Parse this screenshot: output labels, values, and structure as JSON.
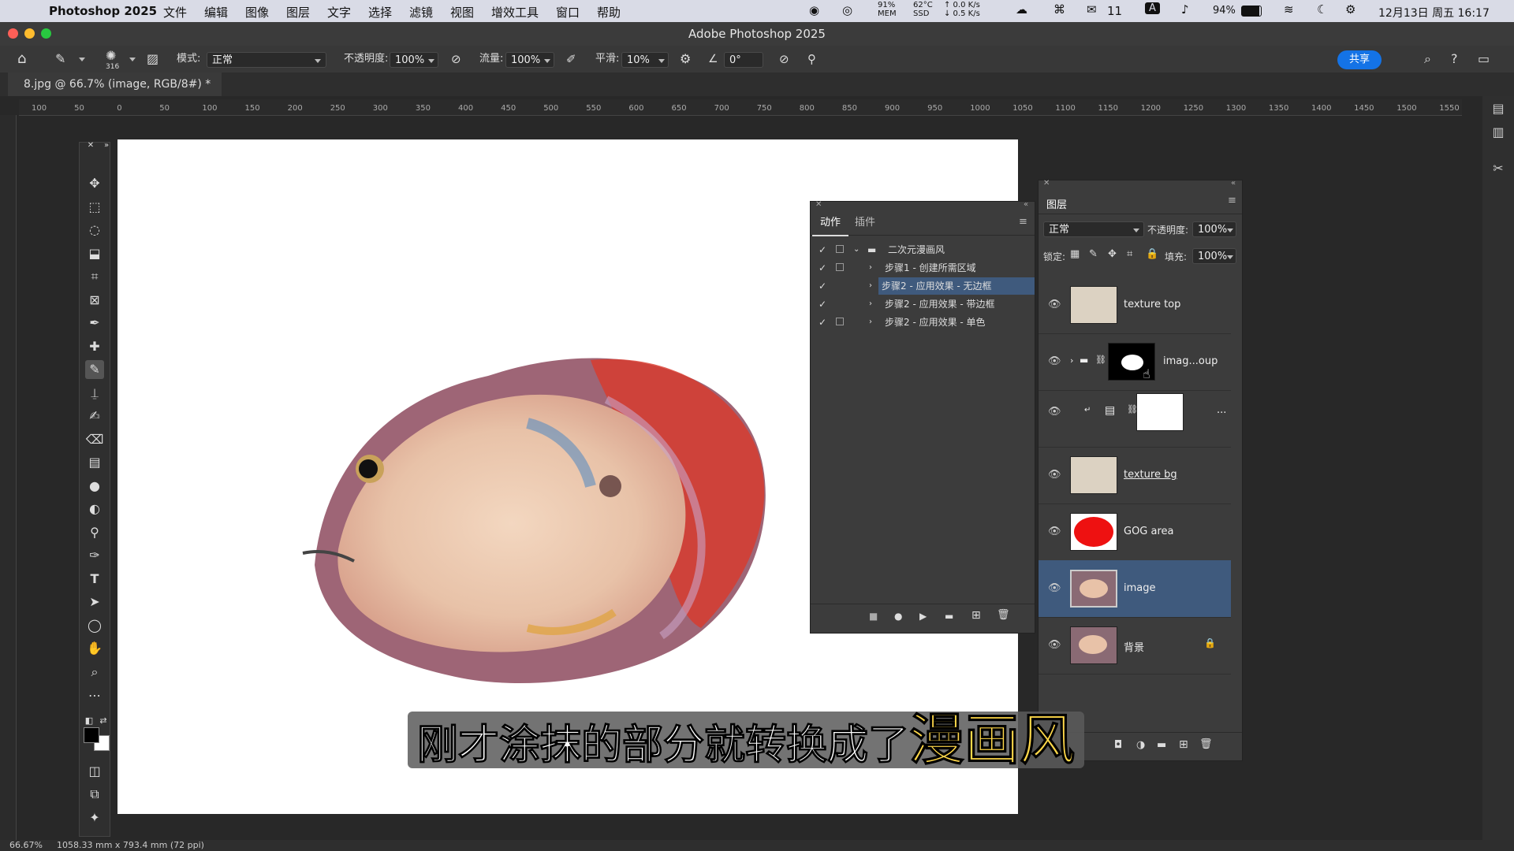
{
  "menubar": {
    "app_name": "Photoshop 2025",
    "items": [
      "文件",
      "编辑",
      "图像",
      "图层",
      "文字",
      "选择",
      "滤镜",
      "视图",
      "增效工具",
      "窗口",
      "帮助"
    ],
    "cpu": "91%",
    "cpu_sub": "MEM",
    "temp": "62°C",
    "temp_sub": "SSD",
    "net_up": "↑ 0.0 K/s",
    "net_down": "↓ 0.5 K/s",
    "wechat_count": "11",
    "input_method": "A",
    "battery": "94%",
    "datetime": "12月13日 周五 16:17"
  },
  "window": {
    "title": "Adobe Photoshop 2025"
  },
  "options": {
    "brush_size": "316",
    "mode_label": "模式:",
    "mode_value": "正常",
    "opacity_label": "不透明度:",
    "opacity_value": "100%",
    "flow_label": "流量:",
    "flow_value": "100%",
    "smooth_label": "平滑:",
    "smooth_value": "10%",
    "angle_value": "0°",
    "share_label": "共享"
  },
  "document": {
    "tab_title": "8.jpg @ 66.7% (image, RGB/8#) *"
  },
  "ruler": {
    "labels": [
      "100",
      "50",
      "0",
      "50",
      "100",
      "150",
      "200",
      "250",
      "300",
      "350",
      "400",
      "450",
      "500",
      "550",
      "600",
      "650",
      "700",
      "750",
      "800",
      "850",
      "900",
      "950",
      "1000",
      "1050",
      "1100",
      "1150",
      "1200",
      "1250",
      "1300",
      "1350",
      "1400",
      "1450",
      "1500",
      "1550"
    ]
  },
  "actions_panel": {
    "tabs": [
      "动作",
      "插件"
    ],
    "set_name": "二次元漫画风",
    "actions": [
      {
        "label": "步骤1 - 创建所需区域",
        "selected": false
      },
      {
        "label": "步骤2 - 应用效果 - 无边框",
        "selected": true
      },
      {
        "label": "步骤2 - 应用效果 - 带边框",
        "selected": false
      },
      {
        "label": "步骤2 - 应用效果 - 单色",
        "selected": false
      }
    ]
  },
  "layers_panel": {
    "title": "图层",
    "blend_mode": "正常",
    "opacity_label": "不透明度:",
    "opacity_value": "100%",
    "lock_label": "锁定:",
    "fill_label": "填充:",
    "fill_value": "100%",
    "layers": [
      {
        "name": "texture top"
      },
      {
        "name": "imag...oup"
      },
      {
        "name": "..."
      },
      {
        "name": "texture bg"
      },
      {
        "name": "GOG area"
      },
      {
        "name": "image"
      },
      {
        "name": "背景"
      }
    ]
  },
  "subtitle": {
    "part1": "刚才涂抹的部分就转换成了",
    "part2": "漫画风"
  },
  "status": {
    "zoom": "66.67%",
    "doc_size": "1058.33 mm x 793.4 mm (72 ppi)"
  },
  "colors": {
    "accent": "#1473e6",
    "selection": "#3f5a7d",
    "subtitle_highlight": "#ffd84a"
  }
}
